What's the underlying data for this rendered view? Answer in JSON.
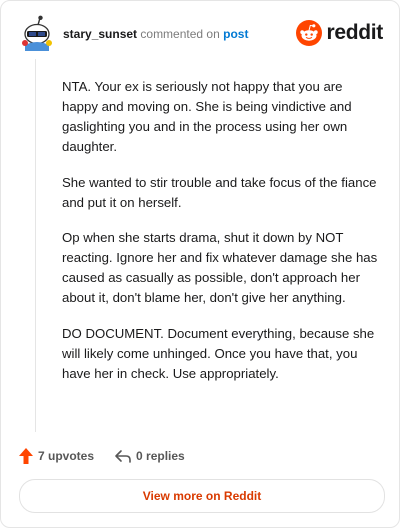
{
  "header": {
    "username": "stary_sunset",
    "action_text": "commented on",
    "post_link": "post",
    "brand": "reddit"
  },
  "comment": {
    "paragraphs": [
      "NTA. Your ex is seriously not happy that you are happy and moving on. She is being vindictive and gaslighting you and in the process using her own daughter.",
      "She wanted to stir trouble and take focus of the fiance and put it on herself.",
      "Op when she starts drama, shut it down by NOT reacting. Ignore her and fix whatever damage she has caused as casually as possible, don't approach her about it, don't blame her, don't give her anything.",
      "DO DOCUMENT. Document everything, because she will likely come unhinged. Once you have that, you have her in check. Use appropriately."
    ]
  },
  "actions": {
    "upvotes": "7 upvotes",
    "replies": "0 replies"
  },
  "footer": {
    "view_more": "View more on Reddit"
  },
  "colors": {
    "brand_orange": "#ff4500",
    "link_blue": "#0079d3",
    "view_more_text": "#d93a00"
  },
  "icons": {
    "avatar": "snoo-avatar-icon",
    "logo": "reddit-logo-icon",
    "upvote": "upvote-arrow-icon",
    "reply": "reply-arrow-icon"
  }
}
